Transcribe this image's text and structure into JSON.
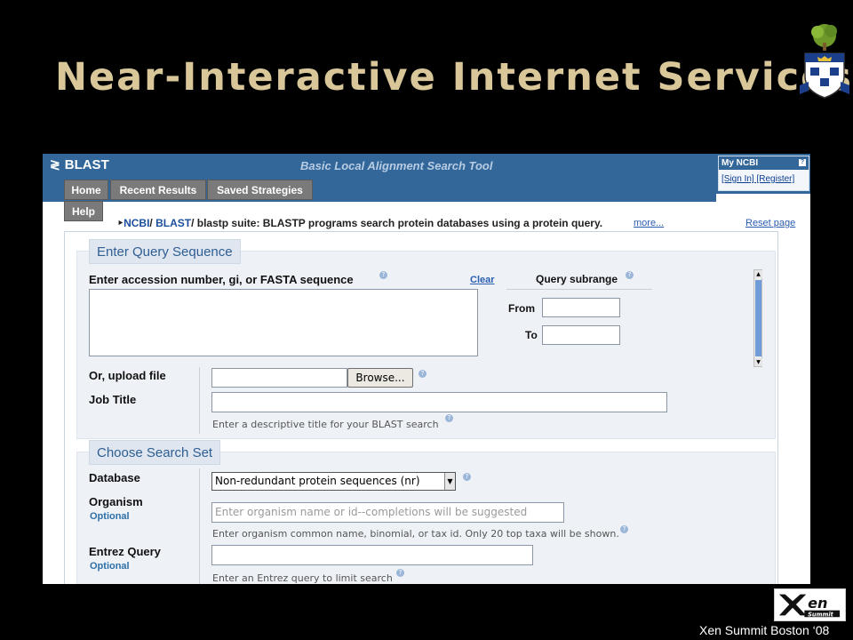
{
  "slide": {
    "title": "Near-Interactive Internet Services",
    "footer": "Xen Summit Boston ‘08",
    "footer_logo": "Xen Summit"
  },
  "blast": {
    "logo": "BLAST",
    "tagline": "Basic Local Alignment Search Tool",
    "tabs": [
      "Home",
      "Recent Results",
      "Saved Strategies",
      "Help"
    ],
    "myncbi": {
      "title": "My NCBI",
      "help": "?",
      "links": "[Sign In] [Register]"
    },
    "breadcrumb": {
      "ncbi": "NCBI",
      "blast": "BLAST",
      "rest": "/ blastp suite: BLASTP programs search protein databases using a protein query.",
      "more": "more...",
      "reset": "Reset page"
    },
    "query": {
      "section_title": "Enter Query Sequence",
      "accession_label": "Enter accession number, gi, or FASTA sequence",
      "clear": "Clear",
      "subrange_title": "Query subrange",
      "from_label": "From",
      "to_label": "To",
      "upload_label": "Or, upload file",
      "browse": "Browse...",
      "job_title_label": "Job Title",
      "job_title_hint": "Enter a descriptive title for your BLAST search"
    },
    "search_set": {
      "section_title": "Choose Search Set",
      "database_label": "Database",
      "database_value": "Non-redundant protein sequences (nr)",
      "organism_label": "Organism",
      "organism_optional": "Optional",
      "organism_placeholder": "Enter organism name or id--completions will be suggested",
      "organism_hint": "Enter organism common name, binomial, or tax id. Only 20 top taxa will be shown.",
      "entrez_label": "Entrez Query",
      "entrez_optional": "Optional",
      "entrez_hint": "Enter an Entrez query to limit search"
    }
  }
}
